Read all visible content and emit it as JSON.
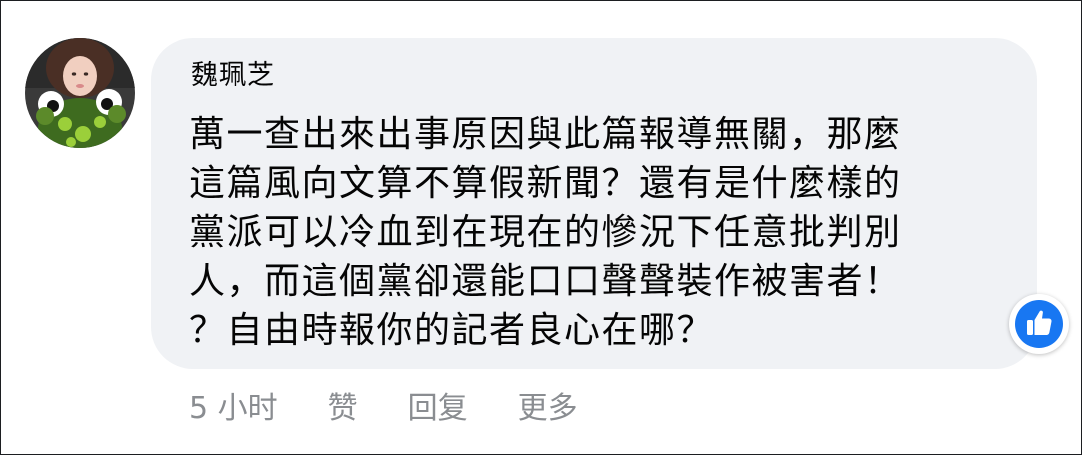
{
  "comment": {
    "author": "魏珮芝",
    "text_lines": [
      "萬一查出來出事原因與此篇報導無關，那麼",
      "這篇風向文算不算假新聞？還有是什麼樣的",
      "黨派可以冷血到在現在的慘況下任意批判別",
      "人，而這個黨卻還能口口聲聲裝作被害者！",
      "？自由時報你的記者良心在哪？"
    ],
    "reaction": "thumbs-up-icon"
  },
  "actions": {
    "timestamp": "5 小时",
    "like_label": "赞",
    "reply_label": "回复",
    "more_label": "更多"
  },
  "colors": {
    "bubble": "#f0f2f5",
    "meta_text": "#8a8d91",
    "like_blue": "#1877f2"
  }
}
